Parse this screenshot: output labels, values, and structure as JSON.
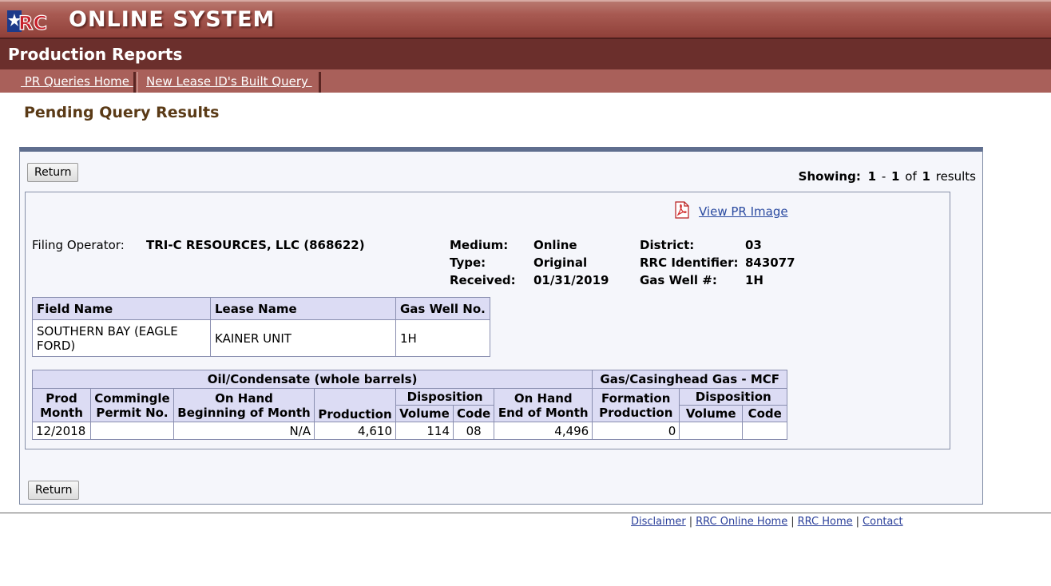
{
  "header": {
    "logo_text": "RRC",
    "system_title": "ONLINE SYSTEM",
    "section_title": "Production Reports"
  },
  "nav": {
    "items": [
      {
        "label": " PR Queries Home "
      },
      {
        "label": "New Lease ID's Built Query "
      }
    ]
  },
  "page": {
    "title": "Pending Query Results",
    "return_label": "Return",
    "showing": {
      "label": "Showing:",
      "from": "1",
      "dash": "-",
      "to": "1",
      "of": "of",
      "total": "1",
      "suffix": "results"
    }
  },
  "report": {
    "view_image_label": "View PR Image",
    "filing_operator_label": "Filing Operator:",
    "filing_operator": "TRI-C RESOURCES, LLC (868622)",
    "medium_label": "Medium:",
    "medium": "Online",
    "type_label": "Type:",
    "type": "Original",
    "received_label": "Received:",
    "received": "01/31/2019",
    "district_label": "District:",
    "district": "03",
    "rrc_id_label": "RRC Identifier:",
    "rrc_id": "843077",
    "gas_well_label": "Gas Well #:",
    "gas_well": "1H"
  },
  "lease_table": {
    "headers": [
      "Field Name",
      "Lease Name",
      "Gas Well No."
    ],
    "row": [
      "SOUTHERN BAY (EAGLE FORD)",
      "KAINER UNIT",
      "1H"
    ]
  },
  "production_table": {
    "group_oil": "Oil/Condensate (whole barrels)",
    "group_gas": "Gas/Casinghead Gas - MCF",
    "h_prod_month": [
      "Prod",
      "Month"
    ],
    "h_commingle": [
      "Commingle",
      "Permit No."
    ],
    "h_on_hand_begin": [
      "On Hand",
      "Beginning of Month"
    ],
    "h_production": "Production",
    "h_disposition": "Disposition",
    "h_volume": "Volume",
    "h_code": "Code",
    "h_on_hand_end": [
      "On Hand",
      "End of Month"
    ],
    "h_formation": [
      "Formation",
      "Production"
    ],
    "row": {
      "prod_month": "12/2018",
      "commingle": "",
      "on_hand_begin": "N/A",
      "production": "4,610",
      "oil_volume": "114",
      "oil_code": "08",
      "on_hand_end": "4,496",
      "formation_production": "0",
      "gas_volume": "",
      "gas_code": ""
    }
  },
  "footer": {
    "links": [
      "Disclaimer",
      "RRC Online Home",
      "RRC Home",
      "Contact"
    ],
    "separator": "|"
  },
  "colors": {
    "header_red": "#a85a52",
    "prodbar": "#6b2f2c",
    "panel_border": "#5f6e8e",
    "table_header": "#dcdcf4"
  }
}
